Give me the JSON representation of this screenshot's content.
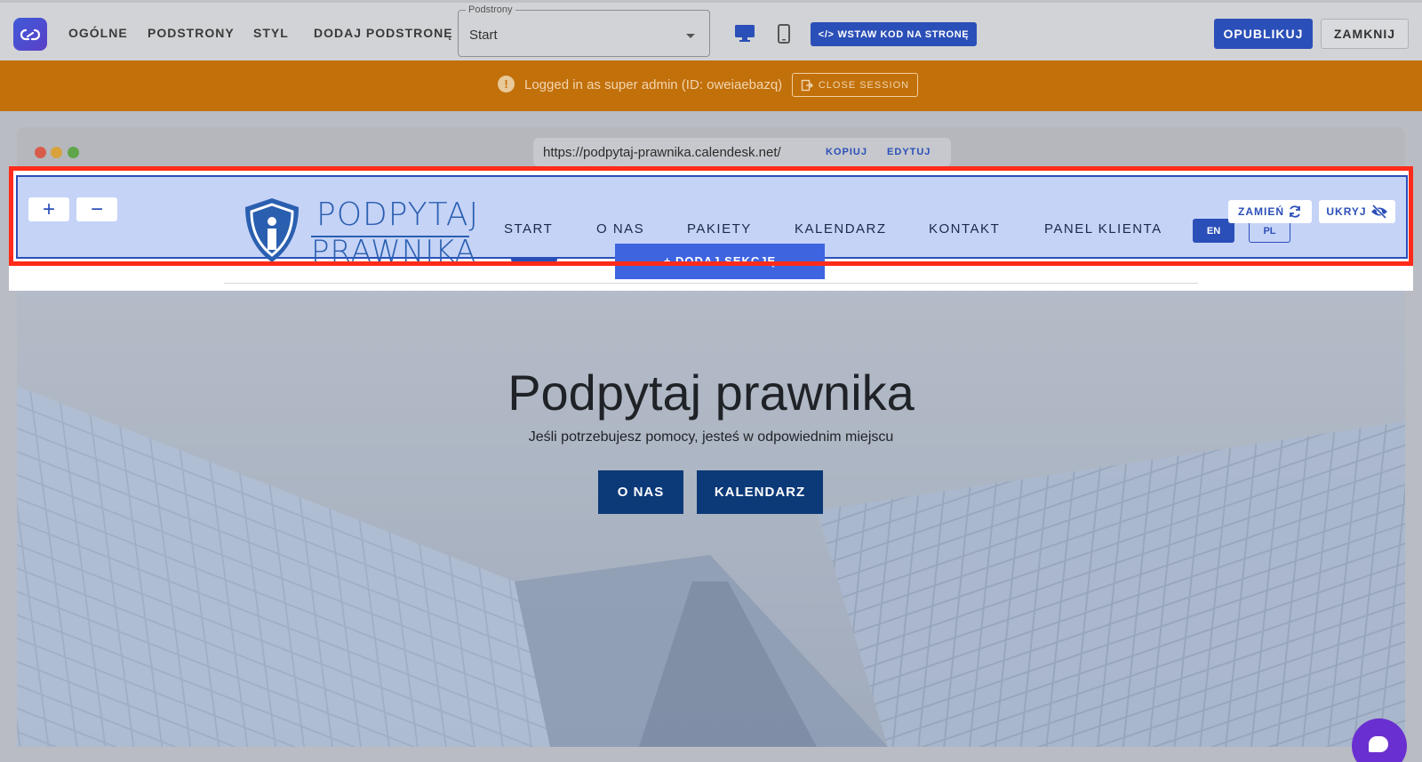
{
  "toolbar": {
    "nav": [
      "OGÓLNE",
      "PODSTRONY",
      "STYL",
      "DODAJ PODSTRONĘ"
    ],
    "subpages_label": "Podstrony",
    "subpages_value": "Start",
    "insert_code_label": "WSTAW KOD NA STRONĘ",
    "publish_label": "OPUBLIKUJ",
    "close_label": "ZAMKNIJ"
  },
  "banner": {
    "text": "Logged in as super admin (ID: oweiaebazq)",
    "button_label": "CLOSE SESSION"
  },
  "browser": {
    "url": "https://podpytaj-prawnika.calendesk.net/",
    "copy_label": "KOPIUJ",
    "edit_label": "EDYTUJ"
  },
  "site_header": {
    "logo_line1": "PODPYTAJ",
    "logo_line2": "PRAWNIKA",
    "nav": [
      "START",
      "O NAS",
      "PAKIETY",
      "KALENDARZ",
      "KONTAKT",
      "PANEL KLIENTA"
    ],
    "languages": [
      "EN",
      "PL"
    ],
    "replace_label": "ZAMIEŃ",
    "hide_label": "UKRYJ",
    "add_section_label": "+ DODAJ SEKCJĘ"
  },
  "hero": {
    "title": "Podpytaj prawnika",
    "subtitle": "Jeśli potrzebujesz pomocy, jesteś w odpowiednim miejscu",
    "button1": "O NAS",
    "button2": "KALENDARZ"
  },
  "colors": {
    "primary": "#2b4fb8",
    "banner": "#c2700a",
    "hero_button": "#0c3a78",
    "highlight": "#ff2b1a"
  }
}
